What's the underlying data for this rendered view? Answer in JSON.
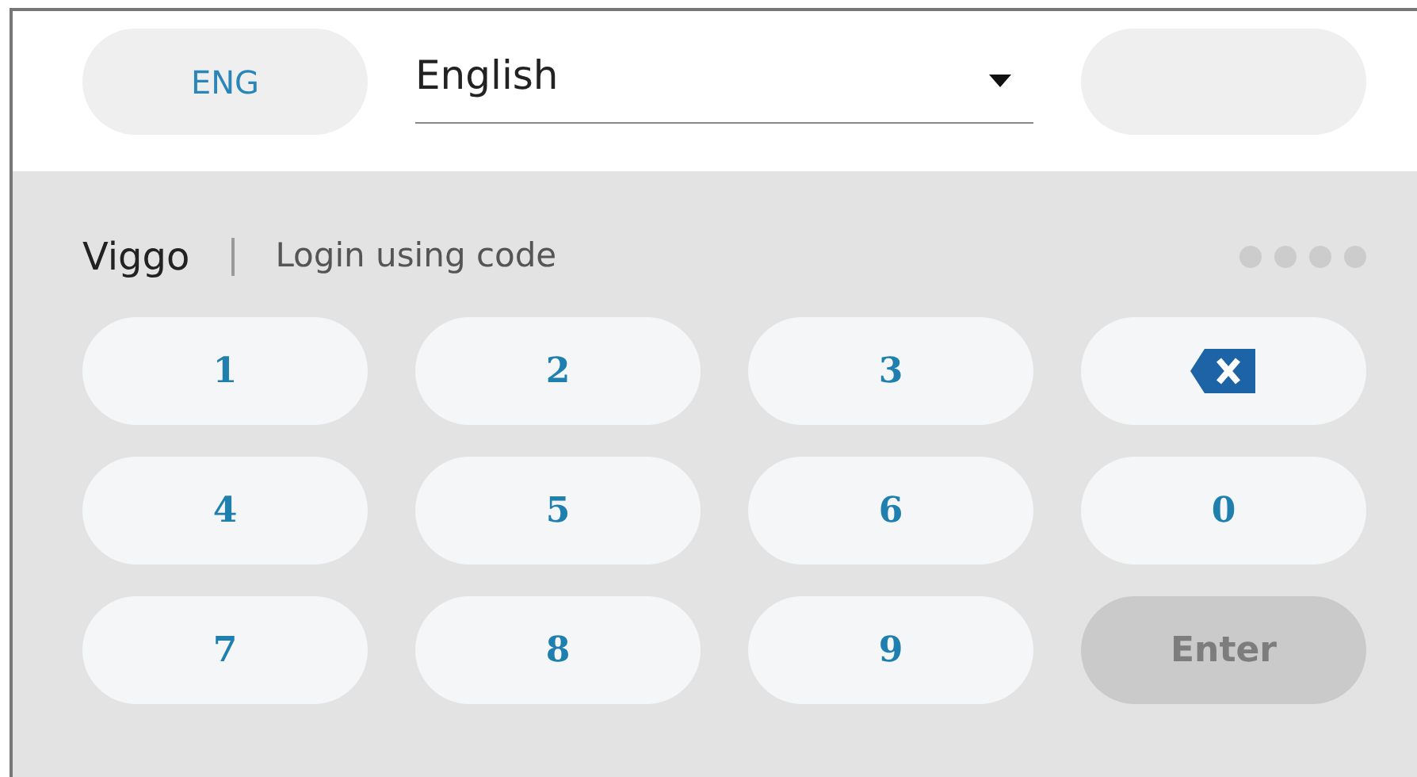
{
  "language_button": {
    "label": "ENG"
  },
  "language_select": {
    "value": "English"
  },
  "user": "Viggo",
  "mode": "Login using code",
  "pin_dots": [
    {
      "filled": false
    },
    {
      "filled": false
    },
    {
      "filled": false
    },
    {
      "filled": false
    }
  ],
  "keys": [
    {
      "kind": "digit",
      "label": "1"
    },
    {
      "kind": "digit",
      "label": "2"
    },
    {
      "kind": "digit",
      "label": "3"
    },
    {
      "kind": "backspace"
    },
    {
      "kind": "digit",
      "label": "4"
    },
    {
      "kind": "digit",
      "label": "5"
    },
    {
      "kind": "digit",
      "label": "6"
    },
    {
      "kind": "digit",
      "label": "0"
    },
    {
      "kind": "digit",
      "label": "7"
    },
    {
      "kind": "digit",
      "label": "8"
    },
    {
      "kind": "digit",
      "label": "9"
    },
    {
      "kind": "enter",
      "label": "Enter",
      "disabled": true
    }
  ]
}
